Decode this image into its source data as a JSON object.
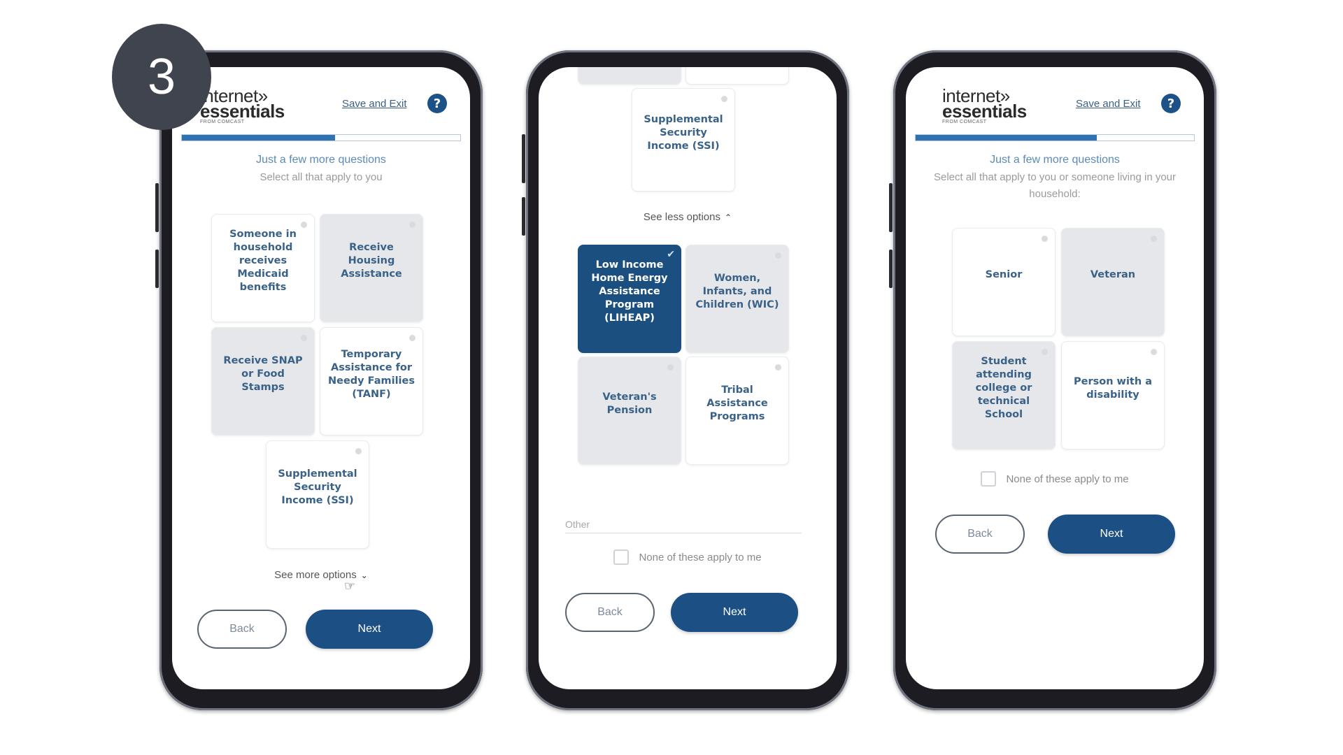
{
  "step_badge": "3",
  "colors": {
    "primary": "#1c5084",
    "selected_card": "#1b4f7f",
    "progress_fill": "#2f72b3",
    "heading": "#5c8ab8",
    "card_text": "#3a6289"
  },
  "brand": {
    "line1": "internet»",
    "line2": "essentials",
    "line3": "FROM COMCAST"
  },
  "phones": [
    {
      "header": {
        "save_exit": "Save and Exit",
        "help_icon": "?"
      },
      "progress_percent": 55,
      "title": "Just a few more questions",
      "subtitle": "Select all that apply to you",
      "cards": [
        {
          "label": "Someone in household receives Medicaid benefits",
          "selected": false
        },
        {
          "label": "Receive Housing Assistance",
          "selected": false
        },
        {
          "label": "Receive SNAP or Food Stamps",
          "selected": false
        },
        {
          "label": "Temporary Assistance for Needy Families (TANF)",
          "selected": false
        },
        {
          "label": "Supplemental Security Income (SSI)",
          "selected": false
        }
      ],
      "toggle": "See more options",
      "back": "Back",
      "next": "Next"
    },
    {
      "cards": [
        {
          "label": "Supplemental Security Income (SSI)",
          "selected": false
        },
        {
          "label": "Low Income Home Energy Assistance Program (LIHEAP)",
          "selected": true
        },
        {
          "label": "Women, Infants, and Children (WIC)",
          "selected": false
        },
        {
          "label": "Veteran's Pension",
          "selected": false
        },
        {
          "label": "Tribal Assistance Programs",
          "selected": false
        }
      ],
      "toggle": "See less options",
      "other_placeholder": "Other",
      "none_label": "None of these apply to me",
      "none_checked": false,
      "back": "Back",
      "next": "Next"
    },
    {
      "header": {
        "save_exit": "Save and Exit",
        "help_icon": "?"
      },
      "progress_percent": 65,
      "title": "Just a few more questions",
      "subtitle": "Select all that apply to you or someone living in your household:",
      "cards": [
        {
          "label": "Senior",
          "selected": false
        },
        {
          "label": "Veteran",
          "selected": false
        },
        {
          "label": "Student attending college or technical School",
          "selected": false
        },
        {
          "label": "Person with a disability",
          "selected": false
        }
      ],
      "none_label": "None of these apply to me",
      "none_checked": false,
      "back": "Back",
      "next": "Next"
    }
  ]
}
